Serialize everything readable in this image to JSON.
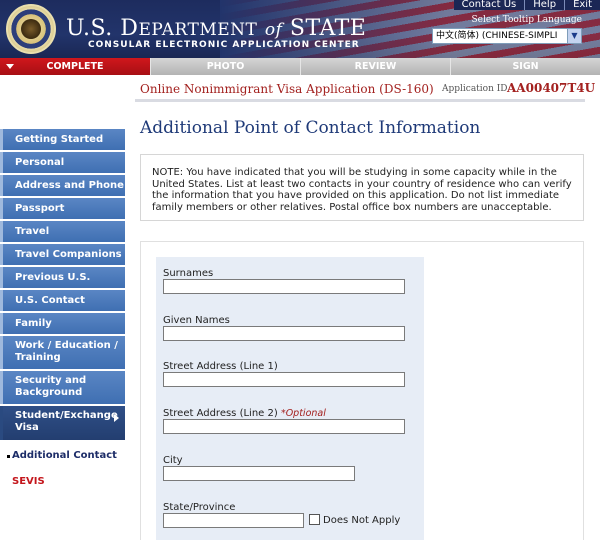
{
  "header": {
    "title_part1": "U.S. D",
    "title_caps": "EPARTMENT",
    "title_of": "of",
    "title_part2": "STATE",
    "subtitle": "CONSULAR ELECTRONIC APPLICATION CENTER",
    "links": [
      "Contact Us",
      "Help",
      "Exit"
    ],
    "tooltip_language_label": "Select Tooltip Language",
    "language_selected": "中文(简体) (CHINESE-SIMPLI"
  },
  "steps": [
    {
      "label": "COMPLETE",
      "active": true
    },
    {
      "label": "PHOTO",
      "active": false
    },
    {
      "label": "REVIEW",
      "active": false
    },
    {
      "label": "SIGN",
      "active": false
    }
  ],
  "application": {
    "name": "Online Nonimmigrant Visa Application (DS-160)",
    "id_label": "Application ID",
    "id_value": "AA00407T4U"
  },
  "sidebar": {
    "items": [
      {
        "label": "Getting Started"
      },
      {
        "label": "Personal"
      },
      {
        "label": "Address and Phone"
      },
      {
        "label": "Passport"
      },
      {
        "label": "Travel"
      },
      {
        "label": "Travel Companions"
      },
      {
        "label": "Previous U.S. Travel"
      },
      {
        "label": "U.S. Contact"
      },
      {
        "label": "Family"
      },
      {
        "label": "Work / Education / Training"
      },
      {
        "label": "Security and Background"
      },
      {
        "label": "Student/Exchange Visa"
      }
    ],
    "sub_items": [
      {
        "label": "Additional Contact"
      },
      {
        "label": "SEVIS"
      }
    ]
  },
  "main": {
    "page_title": "Additional Point of Contact Information",
    "note": "NOTE: You have indicated that you will be studying in some capacity while in the United States. List at least two contacts in your country of residence who can verify the information that you have provided on this application. Do not list immediate family members or other relatives. Postal office box numbers are unacceptable.",
    "form": {
      "surnames_label": "Surnames",
      "surnames_value": "",
      "given_names_label": "Given Names",
      "given_names_value": "",
      "street1_label": "Street Address (Line 1)",
      "street1_value": "",
      "street2_label": "Street Address (Line 2)",
      "optional_label": "*Optional",
      "street2_value": "",
      "city_label": "City",
      "city_value": "",
      "state_label": "State/Province",
      "state_value": "",
      "does_not_apply_label": "Does Not Apply"
    }
  },
  "colors": {
    "header_blue": "#22346b",
    "active_step_red": "#c4161c",
    "nav_blue": "#4a7abb",
    "title_blue": "#1f3a78",
    "app_red": "#a3211f",
    "form_panel_bg": "#e7edf6"
  }
}
